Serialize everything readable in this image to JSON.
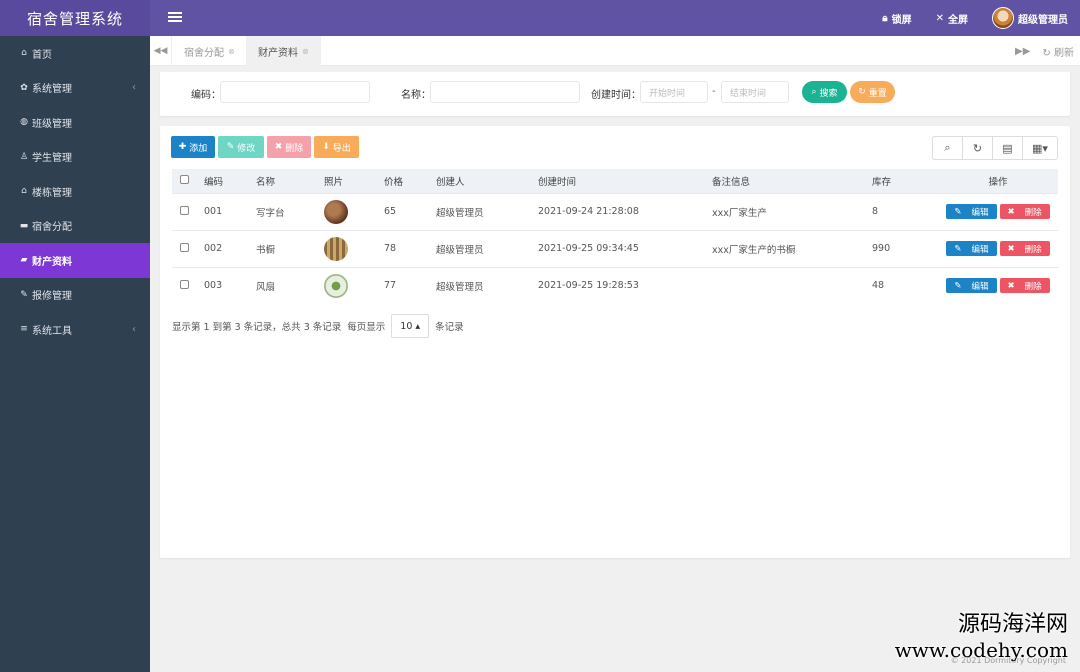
{
  "app": {
    "title": "宿舍管理系统"
  },
  "topbar": {
    "lock": "锁屏",
    "fullscreen": "全屏",
    "user": "超级管理员"
  },
  "sidebar": {
    "items": [
      {
        "icon": "home-icon",
        "glyph": "⌂",
        "label": "首页",
        "arrow": ""
      },
      {
        "icon": "gear-icon",
        "glyph": "✿",
        "label": "系统管理",
        "arrow": "‹"
      },
      {
        "icon": "globe-icon",
        "glyph": "◍",
        "label": "班级管理",
        "arrow": ""
      },
      {
        "icon": "user-icon",
        "glyph": "♙",
        "label": "学生管理",
        "arrow": ""
      },
      {
        "icon": "building-icon",
        "glyph": "⌂",
        "label": "楼栋管理",
        "arrow": ""
      },
      {
        "icon": "bed-icon",
        "glyph": "▬",
        "label": "宿舍分配",
        "arrow": ""
      },
      {
        "icon": "briefcase-icon",
        "glyph": "▰",
        "label": "财产资料",
        "arrow": ""
      },
      {
        "icon": "wrench-icon",
        "glyph": "✎",
        "label": "报修管理",
        "arrow": ""
      },
      {
        "icon": "list-icon",
        "glyph": "≡",
        "label": "系统工具",
        "arrow": "‹"
      }
    ],
    "active_index": 6
  },
  "tabs": {
    "items": [
      "宿舍分配",
      "财产资料"
    ],
    "refresh": "刷新"
  },
  "search": {
    "code_label": "编码：",
    "name_label": "名称：",
    "time_label": "创建时间：",
    "start_placeholder": "开始时间",
    "end_placeholder": "结束时间",
    "dash": "-",
    "search_btn": "搜索",
    "reset_btn": "重置"
  },
  "toolbar": {
    "add": "添加",
    "edit": "修改",
    "delete": "删除",
    "export": "导出"
  },
  "table": {
    "headers": [
      "编码",
      "名称",
      "照片",
      "价格",
      "创建人",
      "创建时间",
      "备注信息",
      "库存",
      "操作"
    ],
    "rows": [
      {
        "code": "001",
        "name": "写字台",
        "price": "65",
        "creator": "超级管理员",
        "time": "2021-09-24 21:28:08",
        "note": "xxx厂家生产",
        "stock": "8"
      },
      {
        "code": "002",
        "name": "书橱",
        "price": "78",
        "creator": "超级管理员",
        "time": "2021-09-25 09:34:45",
        "note": "xxx厂家生产的书橱",
        "stock": "990"
      },
      {
        "code": "003",
        "name": "风扇",
        "price": "77",
        "creator": "超级管理员",
        "time": "2021-09-25 19:28:53",
        "note": "",
        "stock": "48"
      }
    ],
    "edit_btn": "编辑",
    "delete_btn": "删除"
  },
  "pager": {
    "summary": "显示第 1 到第 3 条记录，总共 3 条记录",
    "per_page_prefix": "每页显示",
    "page_size": "10",
    "per_page_suffix": "条记录"
  },
  "footer": {
    "copyright": "© 2021 Dormitory Copyright"
  },
  "watermark": {
    "line1": "源码海洋网",
    "line2": "www.codehy.com"
  },
  "colors": {
    "topbar": "#6153a3",
    "sidebar": "#2f4050",
    "active": "#7c37d4",
    "add": "#1c84c6",
    "edit": "#6fd6c4",
    "delete": "#f4a1aa",
    "export": "#f8ac59",
    "search": "#1ab394"
  }
}
